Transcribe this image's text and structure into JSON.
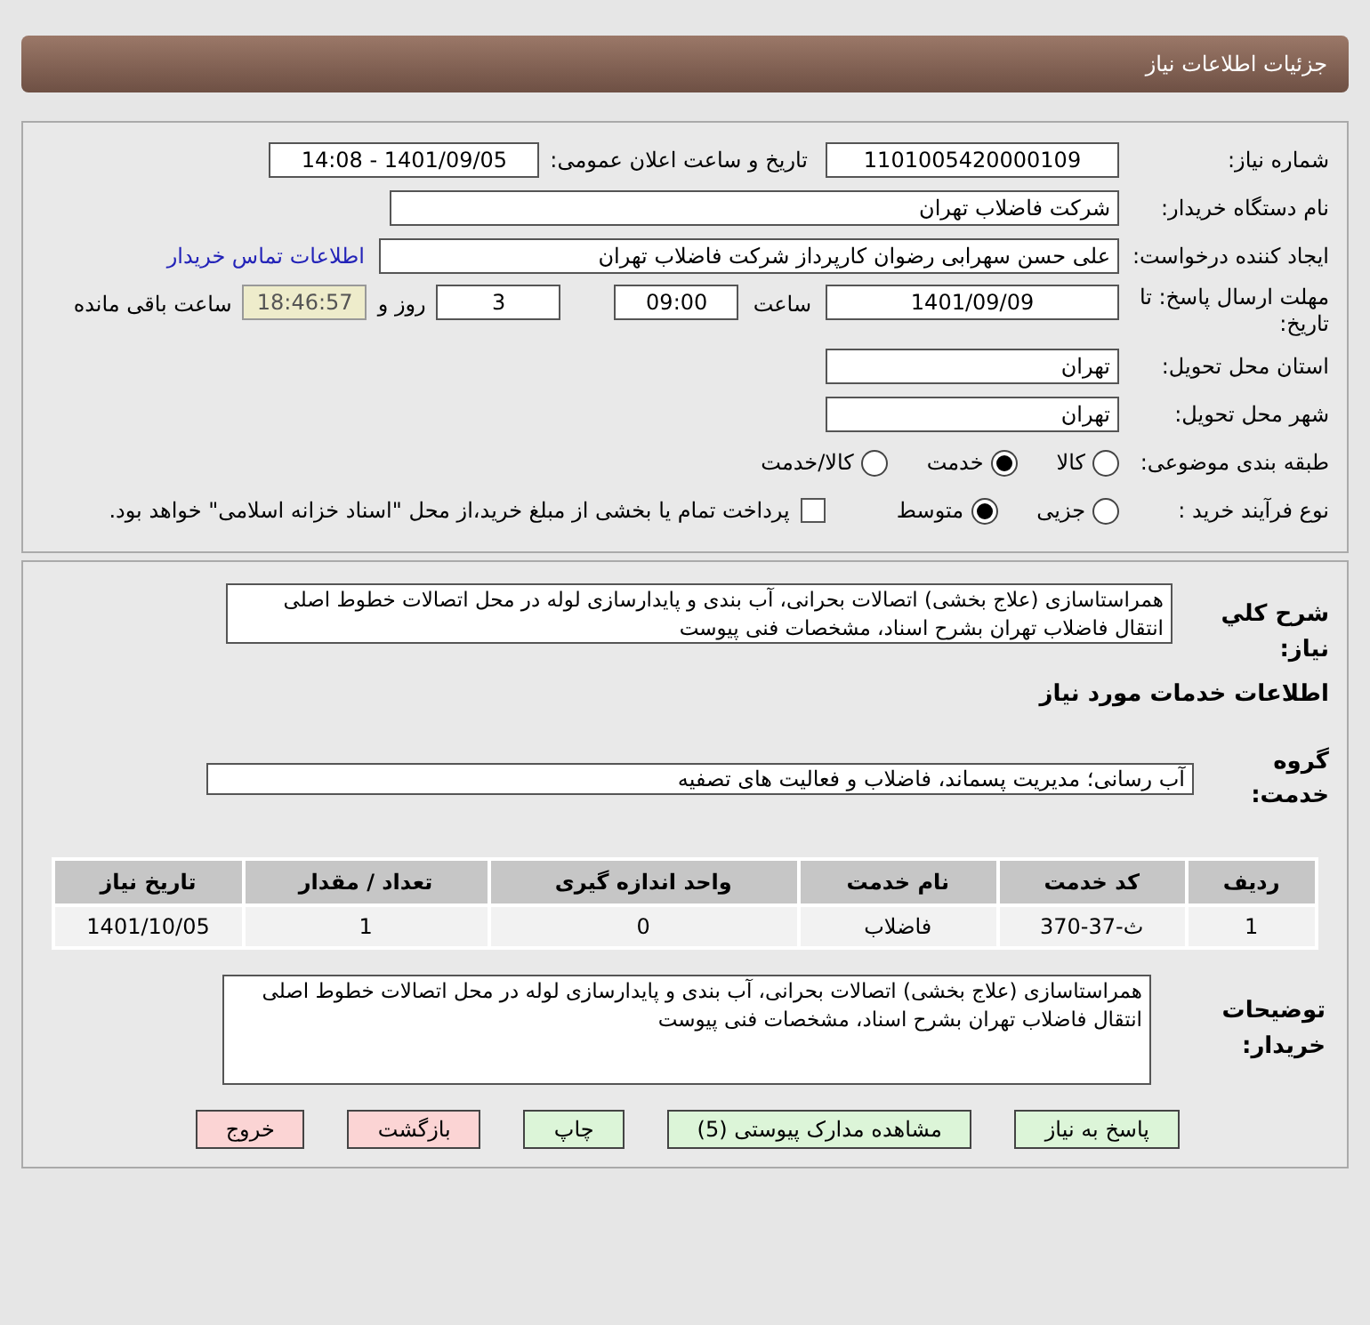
{
  "header": {
    "title": "جزئیات اطلاعات نیاز"
  },
  "details": {
    "need_number": {
      "label": "شماره نیاز:",
      "value": "1101005420000109"
    },
    "announce": {
      "label": "تاریخ و ساعت اعلان عمومی:",
      "value": "1401/09/05 - 14:08"
    },
    "buyer_org": {
      "label": "نام دستگاه خریدار:",
      "value": "شرکت فاضلاب تهران"
    },
    "requester": {
      "label": "ایجاد کننده درخواست:",
      "value": "علی حسن  سهرابی رضوان کارپرداز شرکت فاضلاب تهران",
      "link": "اطلاعات تماس خریدار"
    },
    "deadline": {
      "label": "مهلت ارسال پاسخ: تا تاریخ:",
      "date": "1401/09/09",
      "time_label": "ساعت",
      "time": "09:00",
      "days": "3",
      "days_label": "روز و",
      "remaining": "18:46:57",
      "remaining_label": "ساعت باقی مانده"
    },
    "province": {
      "label": "استان محل تحویل:",
      "value": "تهران"
    },
    "city": {
      "label": "شهر محل تحویل:",
      "value": "تهران"
    },
    "category": {
      "label": "طبقه بندی موضوعی:",
      "options": [
        {
          "label": "کالا",
          "selected": false
        },
        {
          "label": "خدمت",
          "selected": true
        },
        {
          "label": "کالا/خدمت",
          "selected": false
        }
      ]
    },
    "process": {
      "label": "نوع فرآیند خرید :",
      "options": [
        {
          "label": "جزیی",
          "selected": false
        },
        {
          "label": "متوسط",
          "selected": true
        }
      ],
      "payment": {
        "checked": false,
        "label": "پرداخت تمام یا بخشی از مبلغ خرید،از محل \"اسناد خزانه اسلامی\" خواهد بود."
      }
    }
  },
  "summary": {
    "label": "شرح کلي نياز:",
    "value": "همراستاسازی (علاج بخشی) اتصالات بحرانی، آب بندی و پایدارسازی لوله در محل اتصالات خطوط اصلی انتقال فاضلاب تهران بشرح اسناد، مشخصات فنی پیوست"
  },
  "services": {
    "heading": "اطلاعات خدمات مورد نیاز",
    "group_label": "گروه خدمت:",
    "group": "آب رسانی؛ مدیریت پسماند، فاضلاب و فعالیت های تصفیه",
    "table": {
      "columns": [
        "ردیف",
        "کد خدمت",
        "نام خدمت",
        "واحد اندازه گیری",
        "تعداد / مقدار",
        "تاریخ نیاز"
      ],
      "rows": [
        [
          "1",
          "ث-37-370",
          "فاضلاب",
          "0",
          "1",
          "1401/10/05"
        ]
      ]
    }
  },
  "buyer_notes": {
    "label": "توضیحات خریدار:",
    "value": "همراستاسازی (علاج بخشی) اتصالات بحرانی، آب بندی و پایدارسازی لوله در محل اتصالات خطوط اصلی انتقال فاضلاب تهران بشرح اسناد، مشخصات فنی پیوست"
  },
  "buttons": [
    {
      "label": "پاسخ به نیاز",
      "kind": "action"
    },
    {
      "label": "مشاهده مدارک پیوستی (5)",
      "kind": "action"
    },
    {
      "label": "چاپ",
      "kind": "action"
    },
    {
      "label": "بازگشت",
      "kind": "danger"
    },
    {
      "label": "خروج",
      "kind": "danger"
    }
  ]
}
